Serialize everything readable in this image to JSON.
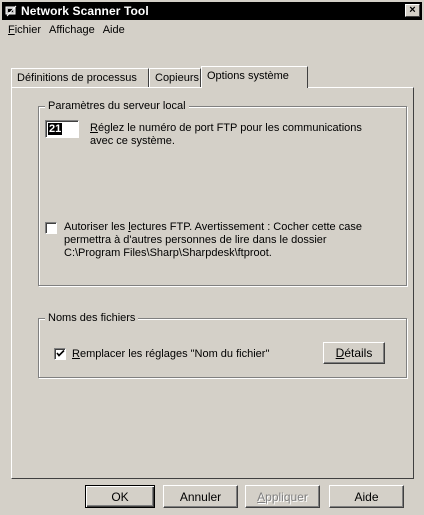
{
  "window": {
    "title": "Network Scanner Tool",
    "close_glyph": "×"
  },
  "menu": {
    "items": [
      {
        "first": "F",
        "rest": "ichier"
      },
      {
        "first": "",
        "rest": "Affichage"
      },
      {
        "first": "",
        "rest": "Aide"
      }
    ]
  },
  "tabs": [
    {
      "label": "Définitions de processus"
    },
    {
      "label": "Copieurs"
    },
    {
      "label": "Options système"
    }
  ],
  "server_group": {
    "label": "Paramètres du serveur local",
    "port_value": "21",
    "port_text_first": "R",
    "port_text_rest_line1": "églez le numéro de port FTP pour les communications",
    "port_text_line2": "avec ce système.",
    "ftp_checkbox_checked": false,
    "ftp_text_line1_pre": "Autoriser les ",
    "ftp_text_line1_u": "l",
    "ftp_text_line1_post": "ectures FTP. Avertissement : Cocher cette case",
    "ftp_text_line2": "permettra à d'autres personnes de lire dans le dossier",
    "ftp_text_line3": "C:\\Program Files\\Sharp\\Sharpdesk\\ftproot."
  },
  "filenames_group": {
    "label": "Noms des fichiers",
    "replace_checked": true,
    "replace_first": "R",
    "replace_rest": "emplacer les réglages \"Nom du fichier\"",
    "details_first": "D",
    "details_rest": "étails"
  },
  "buttons": {
    "ok": "OK",
    "cancel": "Annuler",
    "apply_first": "A",
    "apply_rest": "ppliquer",
    "help": "Aide"
  }
}
